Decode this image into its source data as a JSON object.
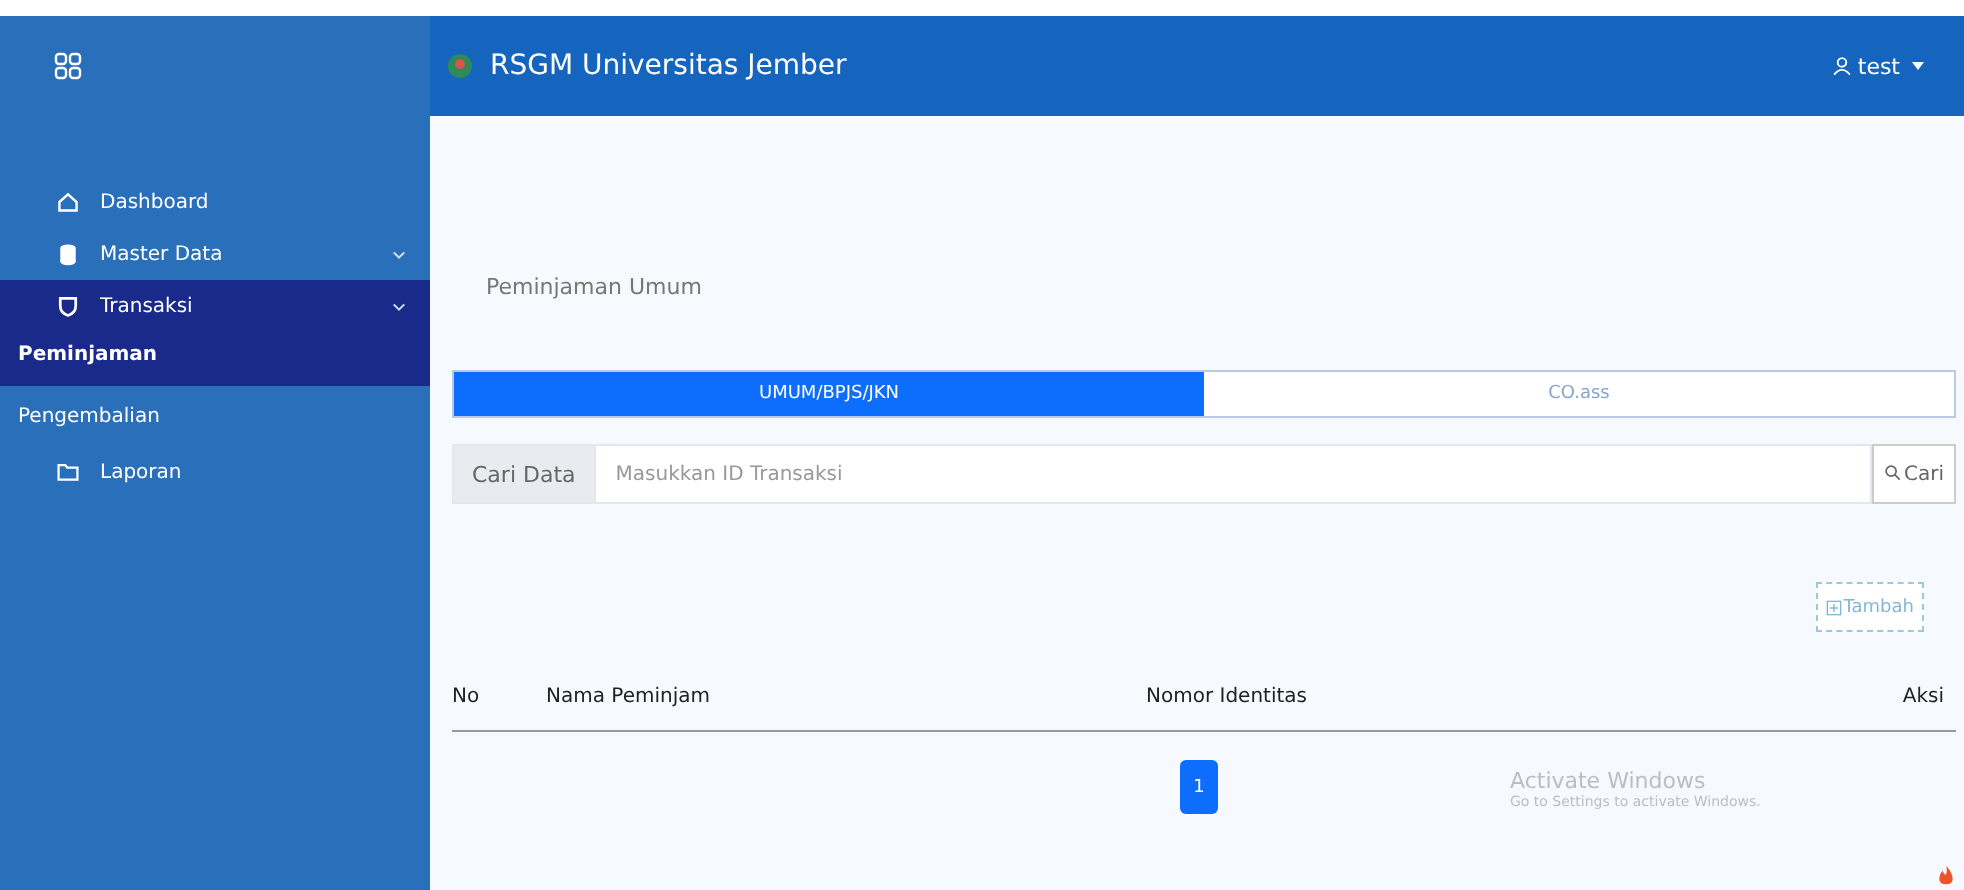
{
  "sidebar": {
    "items": [
      {
        "label": "Dashboard",
        "selected": false,
        "expandable": false
      },
      {
        "label": "Master Data",
        "selected": false,
        "expandable": true
      },
      {
        "label": "Transaksi",
        "selected": true,
        "expandable": true,
        "children": [
          {
            "label": "Peminjaman",
            "selected": true
          }
        ]
      },
      {
        "label": "Pengembalian",
        "selected": false,
        "expandable": false
      },
      {
        "label": "Laporan",
        "selected": false,
        "expandable": false
      }
    ]
  },
  "header": {
    "title": "RSGM Universitas Jember",
    "user": "test"
  },
  "page": {
    "heading": "Peminjaman Umum",
    "tabs": [
      {
        "label": "UMUM/BPJS/JKN",
        "selected": true
      },
      {
        "label": "CO.ass",
        "selected": false
      }
    ],
    "search": {
      "label": "Cari Data",
      "placeholder": "Masukkan ID Transaksi",
      "button": "Cari"
    },
    "add_button": "Tambah",
    "table": {
      "columns": [
        "No",
        "Nama Peminjam",
        "Nomor Identitas",
        "Aksi"
      ]
    },
    "pagination": [
      {
        "label": "1",
        "selected": true
      }
    ]
  },
  "os_notice": {
    "title": "Activate Windows",
    "text": "Go to Settings to activate Windows."
  }
}
